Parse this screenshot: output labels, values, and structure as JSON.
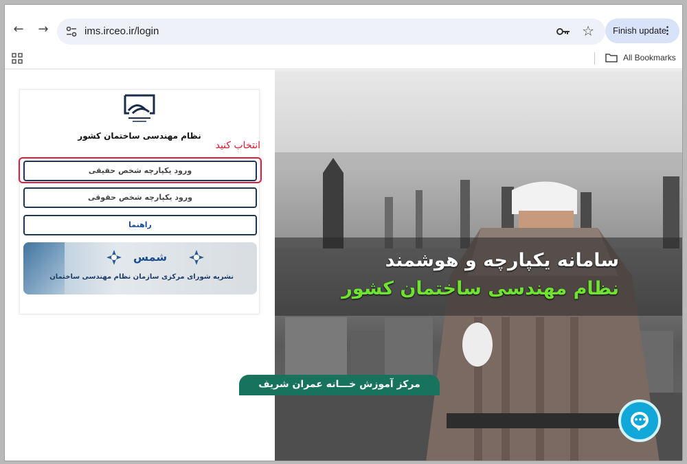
{
  "browser": {
    "url": "ims.irceo.ir/login",
    "finish_update_label": "Finish update",
    "bookmarks_label": "All Bookmarks"
  },
  "login": {
    "org_name": "نظام مهندسی ساختمان کشور",
    "select_note": "انتخاب کنید",
    "btn_natural": "ورود یکپارچه شخص حقیقی",
    "btn_legal": "ورود یکپارچه شخص حقوقی",
    "btn_guide": "راهنما",
    "shams_title": "شمس",
    "shams_subtitle": "نشریه شورای مرکزی سازمان نظام مهندسی ساختمان"
  },
  "hero": {
    "title": "سامانه یکپارچه و هوشمند",
    "subtitle": "نظام مهندسی ساختمان کشور"
  },
  "footer": {
    "label": "مرکز آموزش خـــانه عمران شریف"
  },
  "colors": {
    "select_note": "#e5152f",
    "hero_subtitle": "#6fe332",
    "chat_button": "#11a7d8",
    "footer_tab": "#18735d"
  }
}
